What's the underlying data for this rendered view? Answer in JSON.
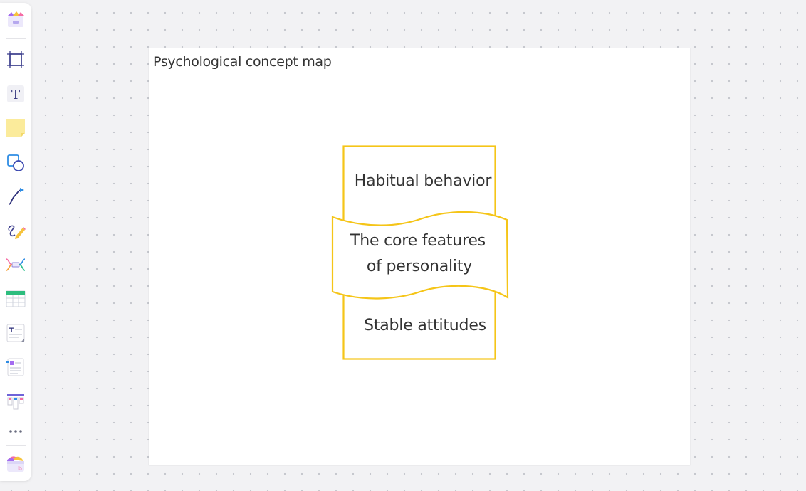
{
  "toolbar": {
    "tools": [
      {
        "name": "app-logo-icon"
      },
      {
        "name": "frame-tool-icon"
      },
      {
        "name": "text-tool-icon",
        "glyph": "T"
      },
      {
        "name": "sticky-note-tool-icon"
      },
      {
        "name": "shape-tool-icon"
      },
      {
        "name": "connector-tool-icon"
      },
      {
        "name": "pen-tool-icon"
      },
      {
        "name": "mindmap-tool-icon"
      },
      {
        "name": "table-tool-icon"
      },
      {
        "name": "text-card-tool-icon",
        "glyph": "T"
      },
      {
        "name": "list-card-tool-icon"
      },
      {
        "name": "kanban-tool-icon"
      },
      {
        "name": "more-tools-icon",
        "glyph": "•••"
      },
      {
        "name": "templates-icon"
      }
    ]
  },
  "frame": {
    "title": "Psychological concept map"
  },
  "diagram": {
    "accent_color": "#f5c518",
    "top_node": "Habitual behavior",
    "center_node": {
      "line1": "The core features",
      "line2": "of personality"
    },
    "bottom_node": "Stable attitudes"
  }
}
